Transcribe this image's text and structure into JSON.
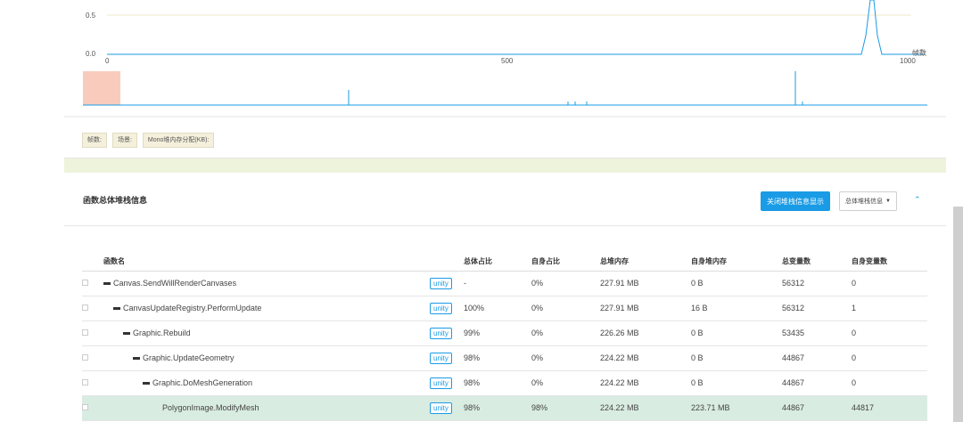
{
  "chart": {
    "y_ticks": [
      "0.5",
      "0.0"
    ],
    "x_ticks": [
      "0",
      "500",
      "1000"
    ],
    "x_unit": "帧数"
  },
  "chips": [
    "帧数:",
    "场景:",
    "Mono堆内存分配(KB):"
  ],
  "stack": {
    "title": "函数总体堆栈信息",
    "close_button": "关闭堆栈信息显示",
    "total_button": "总体堆栈信息",
    "columns": [
      "函数名",
      "总体占比",
      "自身占比",
      "总堆内存",
      "自身堆内存",
      "总变量数",
      "自身变量数"
    ],
    "rows": [
      {
        "name": "Canvas.SendWillRenderCanvases",
        "tag": "unity",
        "total_pct": "-",
        "self_pct": "0%",
        "total_heap": "227.91 MB",
        "self_heap": "0 B",
        "total_vars": "56312",
        "self_vars": "0"
      },
      {
        "name": "CanvasUpdateRegistry.PerformUpdate",
        "tag": "unity",
        "total_pct": "100%",
        "self_pct": "0%",
        "total_heap": "227.91 MB",
        "self_heap": "16 B",
        "total_vars": "56312",
        "self_vars": "1"
      },
      {
        "name": "Graphic.Rebuild",
        "tag": "unity",
        "total_pct": "99%",
        "self_pct": "0%",
        "total_heap": "226.26 MB",
        "self_heap": "0 B",
        "total_vars": "53435",
        "self_vars": "0"
      },
      {
        "name": "Graphic.UpdateGeometry",
        "tag": "unity",
        "total_pct": "98%",
        "self_pct": "0%",
        "total_heap": "224.22 MB",
        "self_heap": "0 B",
        "total_vars": "44867",
        "self_vars": "0"
      },
      {
        "name": "Graphic.DoMeshGeneration",
        "tag": "unity",
        "total_pct": "98%",
        "self_pct": "0%",
        "total_heap": "224.22 MB",
        "self_heap": "0 B",
        "total_vars": "44867",
        "self_vars": "0"
      },
      {
        "name": "PolygonImage.ModifyMesh",
        "tag": "unity",
        "total_pct": "98%",
        "self_pct": "98%",
        "total_heap": "224.22 MB",
        "self_heap": "223.71 MB",
        "total_vars": "44867",
        "self_vars": "44817"
      }
    ]
  },
  "colors": {
    "accent": "#1a9be5",
    "page_bg": "#eef3dc",
    "selection": "#f8cbbd",
    "highlight_row": "#d9ece2"
  }
}
